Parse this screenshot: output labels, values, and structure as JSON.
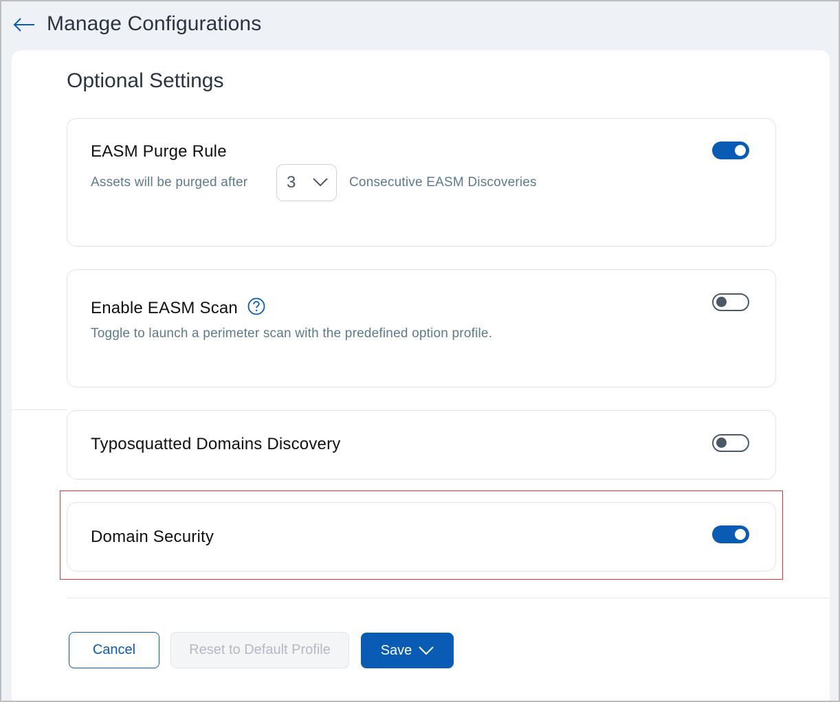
{
  "header": {
    "back_icon": "arrow-left-icon",
    "title": "Manage Configurations"
  },
  "main": {
    "section_title": "Optional Settings",
    "cards": [
      {
        "title": "EASM Purge Rule",
        "desc_prefix": "Assets will be purged after",
        "select_value": "3",
        "desc_suffix": "Consecutive EASM Discoveries",
        "toggle_on": true
      },
      {
        "title": "Enable EASM Scan",
        "help_icon": "question-circle-icon",
        "description": "Toggle to launch a perimeter scan with the predefined option profile.",
        "toggle_on": false
      },
      {
        "title": "Typosquatted Domains Discovery",
        "toggle_on": false
      },
      {
        "title": "Domain Security",
        "toggle_on": true,
        "highlighted": true
      }
    ]
  },
  "footer": {
    "cancel_label": "Cancel",
    "reset_label": "Reset to Default Profile",
    "save_label": "Save"
  },
  "colors": {
    "accent": "#0a5bb3",
    "highlight_border": "#d93636",
    "muted_text": "#5d7a8c"
  }
}
